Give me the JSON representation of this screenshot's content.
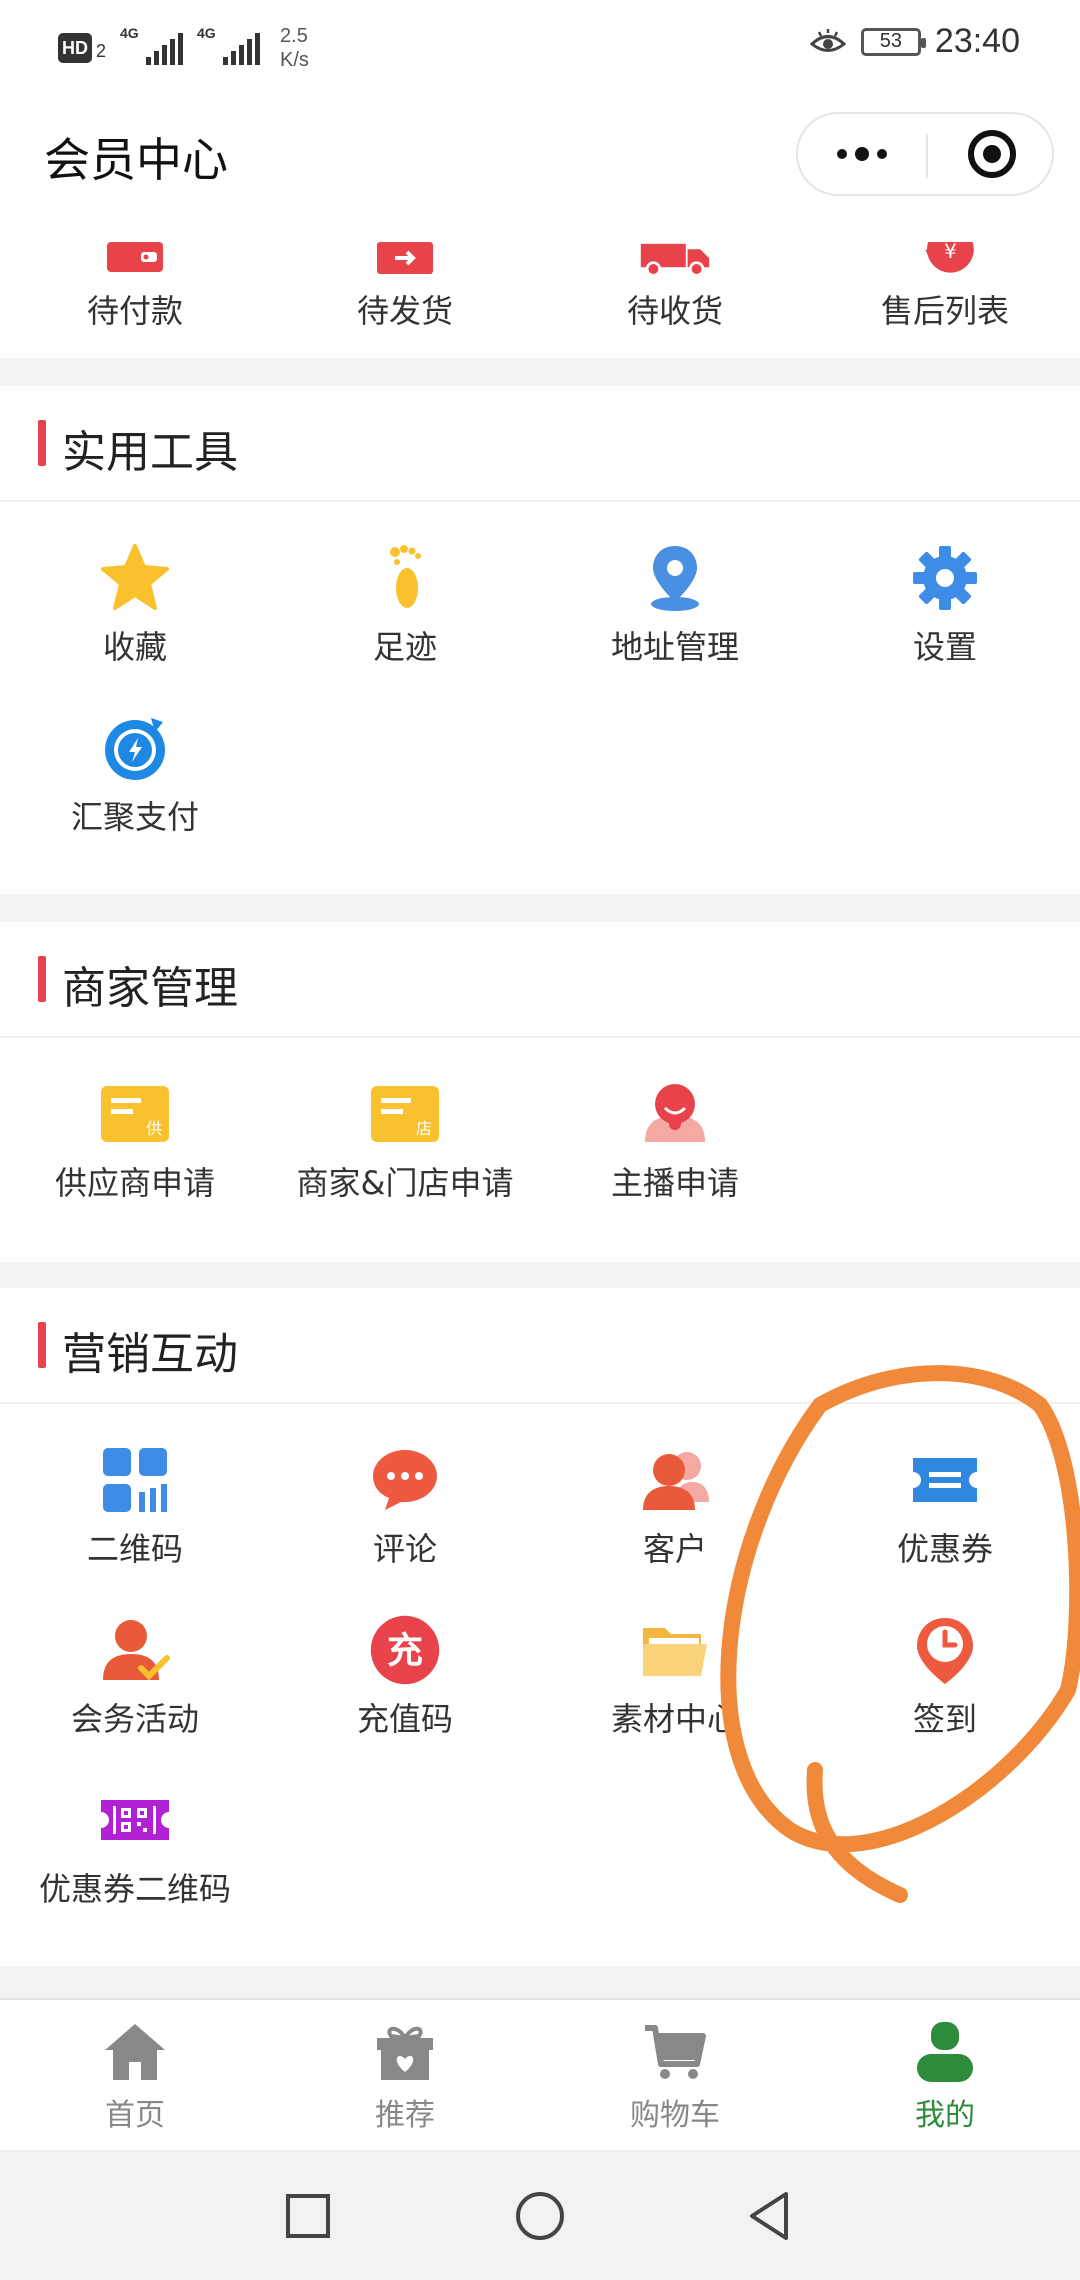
{
  "status_bar": {
    "hd_label": "HD",
    "hd_sub": "2",
    "signal_label": "4G",
    "speed_value": "2.5",
    "speed_unit": "K/s",
    "battery": "53",
    "time": "23:40"
  },
  "header": {
    "title": "会员中心"
  },
  "orders": [
    {
      "label": "待付款",
      "icon": "wallet-icon"
    },
    {
      "label": "待发货",
      "icon": "ship-box-icon"
    },
    {
      "label": "待收货",
      "icon": "truck-icon"
    },
    {
      "label": "售后列表",
      "icon": "refund-icon"
    }
  ],
  "tools": {
    "title": "实用工具",
    "items": [
      {
        "label": "收藏",
        "icon": "star-icon"
      },
      {
        "label": "足迹",
        "icon": "footprint-icon"
      },
      {
        "label": "地址管理",
        "icon": "location-icon"
      },
      {
        "label": "设置",
        "icon": "gear-icon"
      },
      {
        "label": "汇聚支付",
        "icon": "lightning-pay-icon"
      }
    ]
  },
  "merchant": {
    "title": "商家管理",
    "items": [
      {
        "label": "供应商申请",
        "icon": "supplier-card-icon",
        "badge": "供"
      },
      {
        "label": "商家&门店申请",
        "icon": "store-card-icon",
        "badge": "店"
      },
      {
        "label": "主播申请",
        "icon": "anchor-icon"
      }
    ]
  },
  "marketing": {
    "title": "营销互动",
    "items": [
      {
        "label": "二维码",
        "icon": "qrcode-grid-icon"
      },
      {
        "label": "评论",
        "icon": "comment-icon"
      },
      {
        "label": "客户",
        "icon": "customers-icon"
      },
      {
        "label": "优惠券",
        "icon": "coupon-icon"
      },
      {
        "label": "会务活动",
        "icon": "event-user-icon"
      },
      {
        "label": "充值码",
        "icon": "recharge-icon",
        "glyph": "充"
      },
      {
        "label": "素材中心",
        "icon": "folder-icon"
      },
      {
        "label": "签到",
        "icon": "checkin-clock-icon"
      },
      {
        "label": "优惠券二维码",
        "icon": "coupon-qr-icon"
      }
    ]
  },
  "tabbar": [
    {
      "label": "首页",
      "icon": "home-icon",
      "active": false
    },
    {
      "label": "推荐",
      "icon": "gift-icon",
      "active": false
    },
    {
      "label": "购物车",
      "icon": "cart-icon",
      "active": false
    },
    {
      "label": "我的",
      "icon": "user-icon",
      "active": true
    }
  ],
  "colors": {
    "accent_red": "#e8434a",
    "active_green": "#2c8c3a",
    "annotation_orange": "#f08a3a"
  }
}
